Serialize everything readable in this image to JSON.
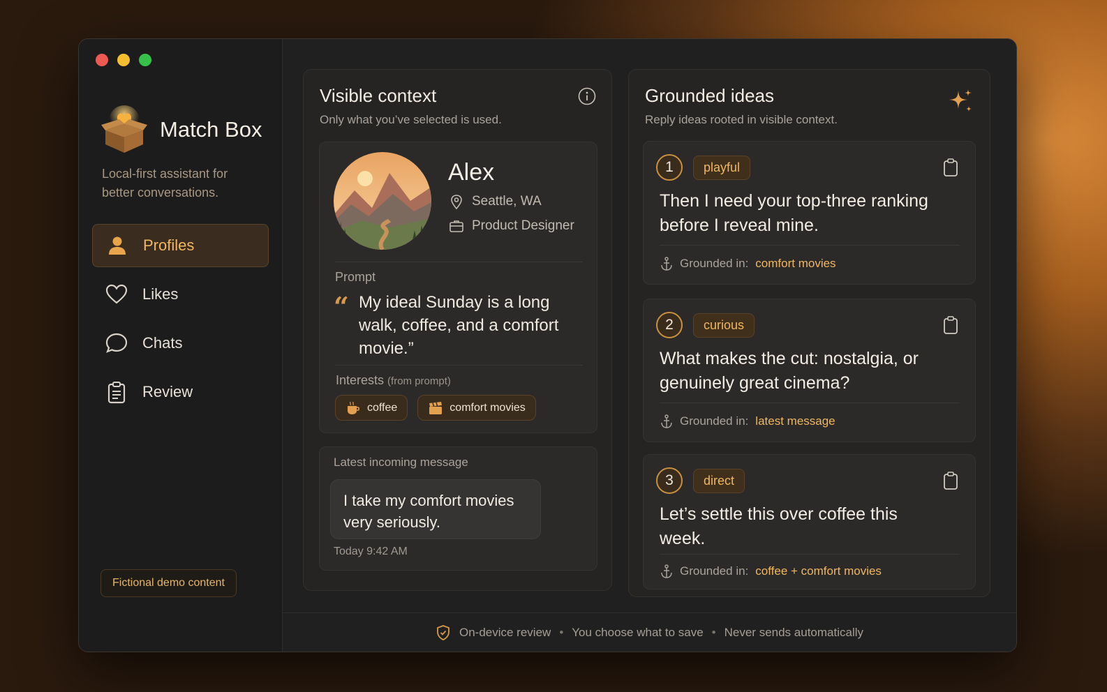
{
  "app": {
    "name": "Match Box",
    "tagline": "Local-first assistant for better conversations."
  },
  "sidebar": {
    "items": [
      {
        "label": "Profiles",
        "icon": "person-icon",
        "active": true
      },
      {
        "label": "Likes",
        "icon": "heart-icon",
        "active": false
      },
      {
        "label": "Chats",
        "icon": "chat-bubble-icon",
        "active": false
      },
      {
        "label": "Review",
        "icon": "clipboard-icon",
        "active": false
      }
    ],
    "demo_badge": "Fictional demo content"
  },
  "context": {
    "title": "Visible context",
    "subtitle": "Only what you’ve selected is used.",
    "profile": {
      "name": "Alex",
      "location": "Seattle, WA",
      "job": "Product Designer",
      "prompt_label": "Prompt",
      "quote_mark": "“",
      "prompt_text": "My ideal Sunday is a long walk, coffee, and a comfort movie.”",
      "interests_label": "Interests",
      "interests_note": "(from prompt)",
      "interests": [
        "coffee",
        "comfort movies"
      ]
    },
    "message": {
      "label": "Latest incoming message",
      "text": "I take my comfort movies very seriously.",
      "time": "Today 9:42 AM"
    }
  },
  "ideas": {
    "title": "Grounded ideas",
    "subtitle": "Reply ideas rooted in visible context.",
    "grounded_label": "Grounded in:",
    "items": [
      {
        "num": "1",
        "tag": "playful",
        "text": "Then I need your top-three ranking before I reveal mine.",
        "source": "comfort movies"
      },
      {
        "num": "2",
        "tag": "curious",
        "text": "What makes the cut: nostalgia, or genuinely great cinema?",
        "source": "latest message"
      },
      {
        "num": "3",
        "tag": "direct",
        "text": "Let’s settle this over coffee this week.",
        "source": "coffee + comfort movies"
      }
    ]
  },
  "footer": {
    "items": [
      "On-device review",
      "You choose what to save",
      "Never sends automatically"
    ],
    "separator": "•"
  },
  "colors": {
    "accent": "#f0b661",
    "background": "#202020",
    "panel": "#252423"
  }
}
